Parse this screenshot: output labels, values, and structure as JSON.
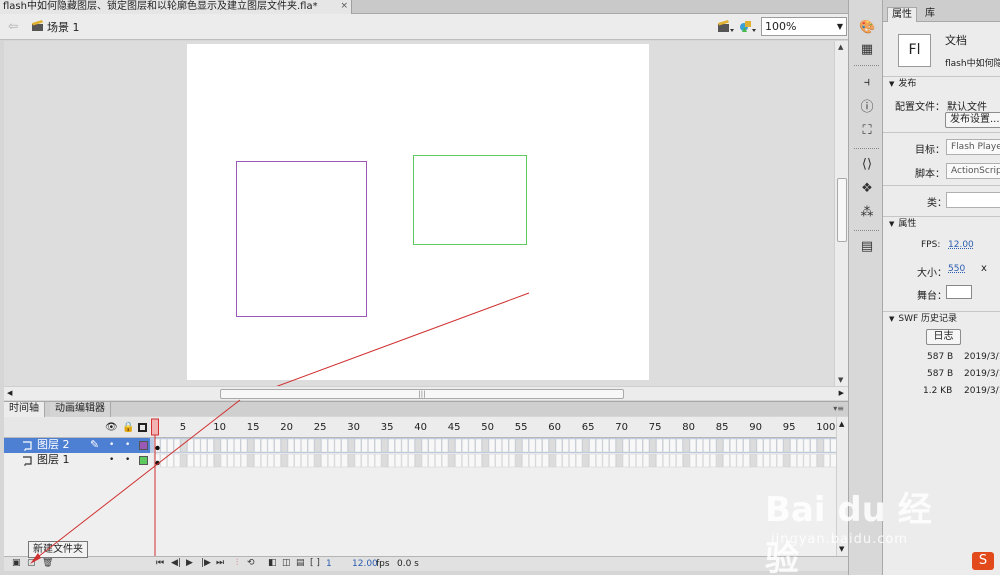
{
  "document_tab": {
    "title": "flash中如何隐藏图层、锁定图层和以轮廓色显示及建立图层文件夹.fla*",
    "close": "×"
  },
  "scene_bar": {
    "scene_label": "场景 1",
    "zoom": "100%"
  },
  "stage": {
    "shapes": [
      {
        "kind": "rect",
        "stroke": "#9b59b6"
      },
      {
        "kind": "rect",
        "stroke": "#5ec95e"
      },
      {
        "kind": "line",
        "stroke": "#d03030"
      }
    ]
  },
  "timeline": {
    "tabs": [
      "时间轴",
      "动画编辑器"
    ],
    "header_icons": [
      "eye-icon",
      "lock-icon",
      "outline-icon"
    ],
    "frame_numbers": [
      "1",
      "5",
      "10",
      "15",
      "20",
      "25",
      "30",
      "35",
      "40",
      "45",
      "50",
      "55",
      "60",
      "65",
      "70",
      "75",
      "80",
      "85",
      "90",
      "95",
      "100"
    ],
    "layers": [
      {
        "name": "图层 2",
        "selected": true,
        "color": "#9b59b6"
      },
      {
        "name": "图层 1",
        "selected": false,
        "color": "#5ec95e"
      }
    ],
    "status": {
      "frame": "1",
      "fps": "12.00",
      "fps_unit": "fps",
      "time": "0.0 s"
    },
    "tooltip": "新建文件夹"
  },
  "properties": {
    "tabs": [
      "属性",
      "库"
    ],
    "doc_type": "文档",
    "doc_icon": "Fl",
    "doc_name": "flash中如何隐",
    "publish": {
      "section": "发布",
      "profile_label": "配置文件：",
      "profile_value": "默认文件",
      "settings_button": "发布设置...",
      "target_label": "目标：",
      "target_value": "Flash Playe",
      "script_label": "脚本：",
      "script_value": "ActionScrip",
      "class_label": "类："
    },
    "props": {
      "section": "属性",
      "fps_label": "FPS:",
      "fps_value": "12.00",
      "size_label": "大小：",
      "size_value": "550",
      "size_x": "x",
      "stage_label": "舞台："
    },
    "swf": {
      "section": "SWF 历史记录",
      "log_button": "日志",
      "rows": [
        {
          "size": "587 B",
          "date": "2019/3/1"
        },
        {
          "size": "587 B",
          "date": "2019/3/1"
        },
        {
          "size": "1.2 KB",
          "date": "2019/3/1"
        }
      ]
    }
  },
  "watermark": {
    "brand": "Bai du 经验",
    "url": "jingyan.baidu.com"
  }
}
